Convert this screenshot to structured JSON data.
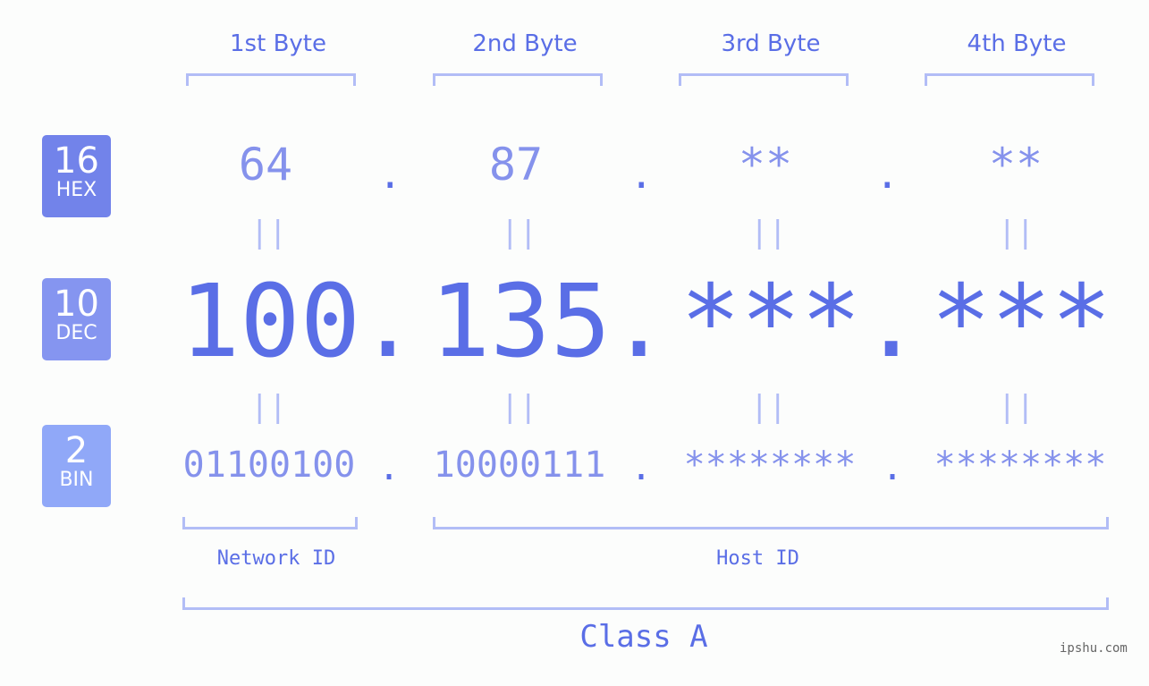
{
  "headers": [
    "1st Byte",
    "2nd Byte",
    "3rd Byte",
    "4th Byte"
  ],
  "badges": {
    "hex": {
      "num": "16",
      "label": "HEX",
      "color": "#7283ea"
    },
    "dec": {
      "num": "10",
      "label": "DEC",
      "color": "#8595f0"
    },
    "bin": {
      "num": "2",
      "label": "BIN",
      "color": "#90a8f8"
    }
  },
  "hex_values": [
    "64",
    "87",
    "**",
    "**"
  ],
  "dec_values": [
    "100",
    "135",
    "***",
    "***"
  ],
  "bin_values": [
    "01100100",
    "10000111",
    "********",
    "********"
  ],
  "separator": ".",
  "equals": "||",
  "network_label": "Network ID",
  "host_label": "Host ID",
  "class_label": "Class A",
  "watermark": "ipshu.com",
  "colors": {
    "primary": "#5a6ee6",
    "light": "#8592ec",
    "bracket": "#b2bdf6"
  }
}
